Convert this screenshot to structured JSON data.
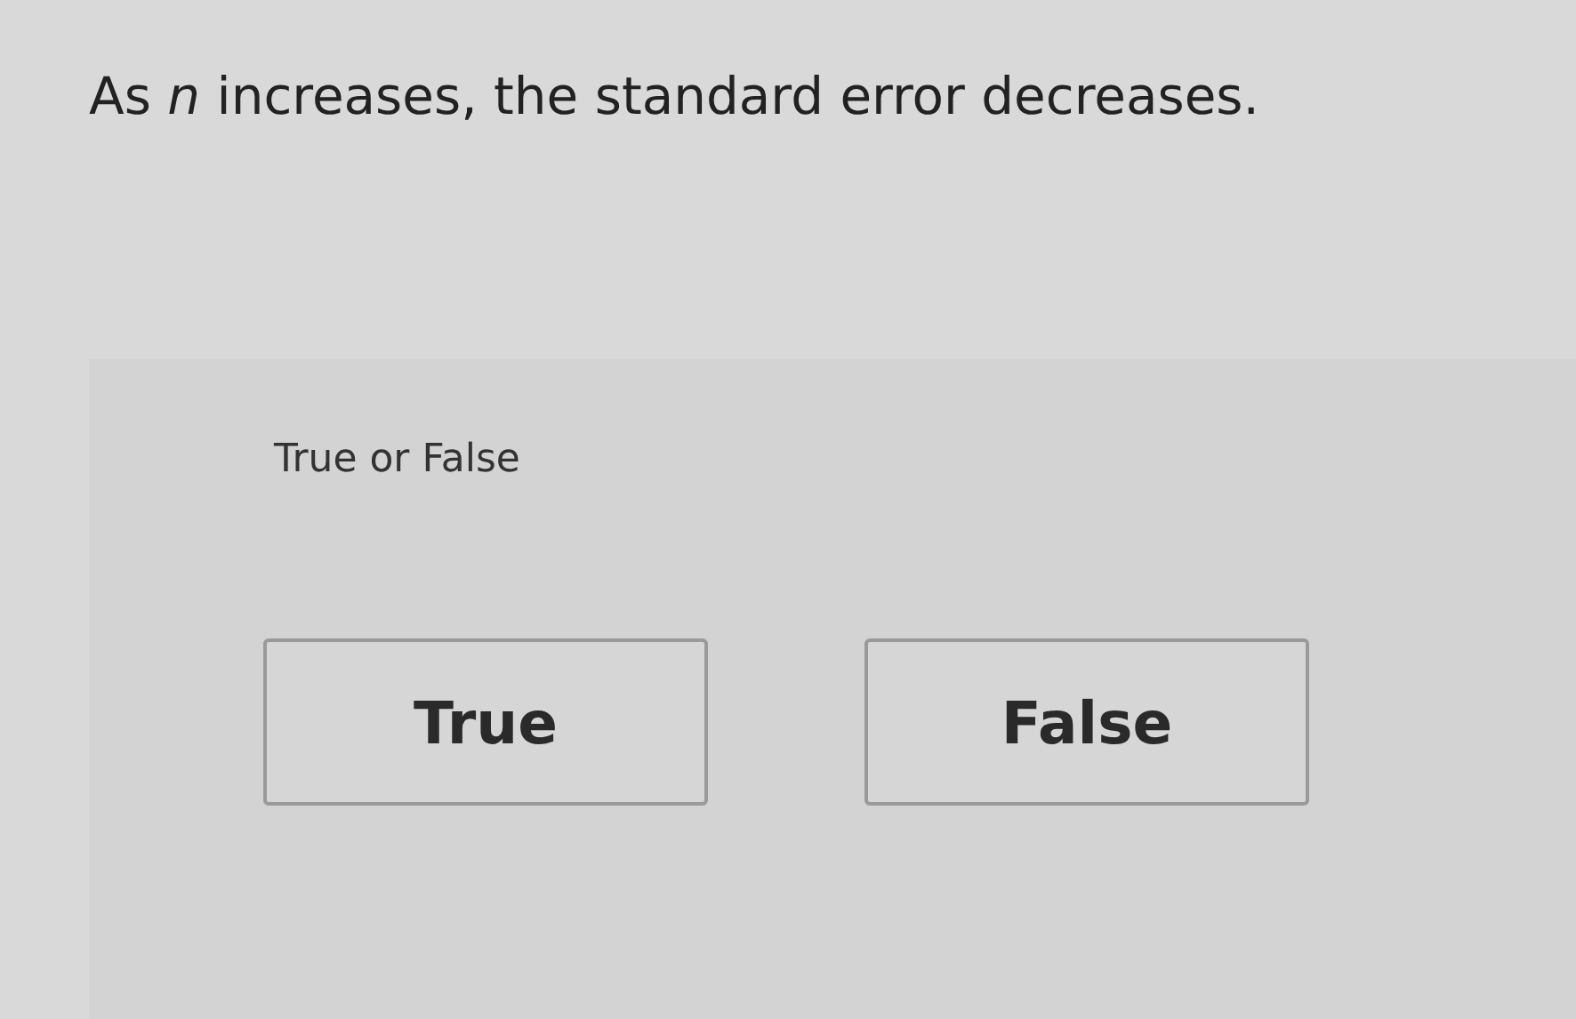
{
  "question": "As *n* increases, the standard error decreases.",
  "prompt": "True or False",
  "options": [
    {
      "label": "True",
      "selected": false
    },
    {
      "label": "False",
      "selected": false
    }
  ]
}
